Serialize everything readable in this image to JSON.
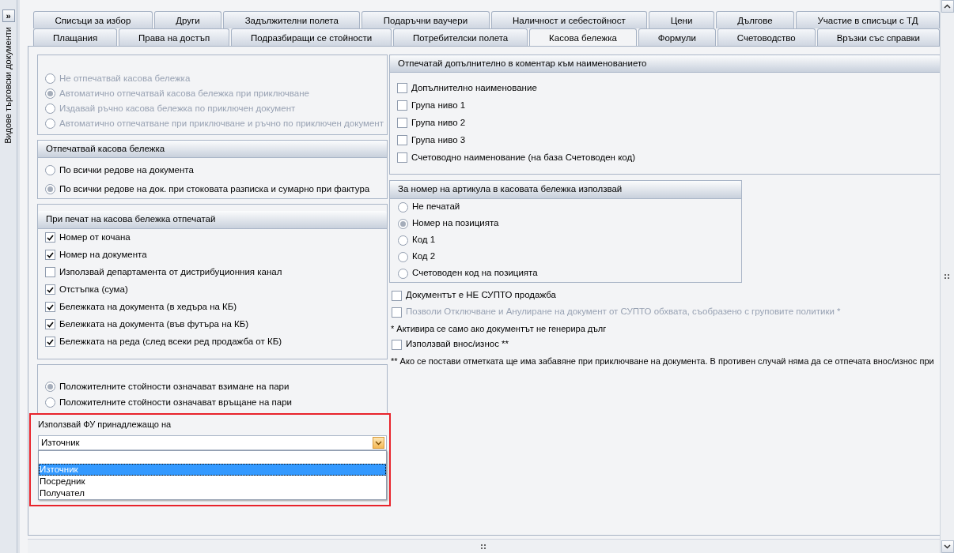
{
  "sidebar": {
    "toggle": "»",
    "title": "Видове търговски документи"
  },
  "tabs_row_1": [
    {
      "label": "Списъци за избор",
      "selected": false
    },
    {
      "label": "Други",
      "selected": false
    },
    {
      "label": "Задължителни полета",
      "selected": false
    },
    {
      "label": "Подаръчни ваучери",
      "selected": false
    },
    {
      "label": "Наличност и себестойност",
      "selected": false
    },
    {
      "label": "Цени",
      "selected": false
    },
    {
      "label": "Дългове",
      "selected": false
    },
    {
      "label": "Участие в списъци с ТД",
      "selected": false
    }
  ],
  "tabs_row_2": [
    {
      "label": "Плащания",
      "selected": false
    },
    {
      "label": "Права на достъп",
      "selected": false
    },
    {
      "label": "Подразбиращи се стойности",
      "selected": false
    },
    {
      "label": "Потребителски полета",
      "selected": false
    },
    {
      "label": "Касова бележка",
      "selected": true
    },
    {
      "label": "Формули",
      "selected": false
    },
    {
      "label": "Счетоводство",
      "selected": false
    },
    {
      "label": "Връзки със справки",
      "selected": false
    }
  ],
  "receipt_mode": {
    "disabled": true,
    "options": [
      {
        "label": "Не отпечатвай касова бележка",
        "selected": false
      },
      {
        "label": "Автоматично отпечатвай касова бележка при приключване",
        "selected": true
      },
      {
        "label": "Издавай ръчно касова бележка по приключен документ",
        "selected": false
      },
      {
        "label": "Автоматично отпечатване при приключване и ръчно по приключен документ",
        "selected": false
      }
    ]
  },
  "print_receipt": {
    "title": "Отпечатвай касова бележка",
    "options": [
      {
        "label": "По всички редове на документа",
        "selected": false
      },
      {
        "label": "По всички редове на док. при стоковата разписка и сумарно при фактура",
        "selected": true
      }
    ]
  },
  "print_on_receipt": {
    "title": "При печат на касова бележка отпечатай",
    "items": [
      {
        "label": "Номер от кочана",
        "checked": true
      },
      {
        "label": "Номер на документа",
        "checked": true
      },
      {
        "label": "Използвай департамента от дистрибуционния канал",
        "checked": false
      },
      {
        "label": "Отстъпка (сума)",
        "checked": true
      },
      {
        "label": "Бележката на документа (в хедъра на КБ)",
        "checked": true
      },
      {
        "label": "Бележката на документа (във футъра на КБ)",
        "checked": true
      },
      {
        "label": "Бележката на реда (след всеки ред продажба от КБ)",
        "checked": true
      }
    ]
  },
  "money_sign": {
    "options": [
      {
        "label": "Положителните стойности означават взимане на пари",
        "selected": true
      },
      {
        "label": "Положителните стойности означават връщане на пари",
        "selected": false
      }
    ]
  },
  "fiscal_device": {
    "label": "Използвай ФУ принадлежащо на",
    "value": "Източник",
    "expanded": true,
    "highlighted": true,
    "options": [
      {
        "label": "Източник",
        "selected": true
      },
      {
        "label": "Посредник",
        "selected": false
      },
      {
        "label": "Получател",
        "selected": false
      }
    ]
  },
  "name_comment": {
    "title": "Отпечатай допълнително в коментар към наименованието",
    "items": [
      {
        "label": "Допълнително наименование",
        "checked": false
      },
      {
        "label": "Група ниво 1",
        "checked": false
      },
      {
        "label": "Група ниво 2",
        "checked": false
      },
      {
        "label": "Група ниво 3",
        "checked": false
      },
      {
        "label": "Счетоводно наименование (на база Счетоводен код)",
        "checked": false
      }
    ]
  },
  "article_number": {
    "title": "За номер на артикула в касовата бележка използвай",
    "options": [
      {
        "label": "Не печатай",
        "selected": false
      },
      {
        "label": "Номер на позицията",
        "selected": true
      },
      {
        "label": "Код 1",
        "selected": false
      },
      {
        "label": "Код 2",
        "selected": false
      },
      {
        "label": "Счетоводен код на позицията",
        "selected": false
      }
    ]
  },
  "extra_options": [
    {
      "kind": "checkbox",
      "label": "Документът е НЕ СУПТО продажба",
      "checked": false,
      "disabled": false
    },
    {
      "kind": "checkbox",
      "label": "Позволи Отключване и Анулиране на документ от СУПТО обхвата, съобразено с груповите политики *",
      "checked": false,
      "disabled": true
    },
    {
      "kind": "note",
      "text": "* Активира се само ако документът не генерира дълг"
    },
    {
      "kind": "checkbox",
      "label": "Използвай внос/износ **",
      "checked": false,
      "disabled": false
    },
    {
      "kind": "note",
      "text": "** Ако се постави отметката ще има забавяне при приключване на документа. В противен случай няма да се отпечата внос/износ при"
    }
  ]
}
